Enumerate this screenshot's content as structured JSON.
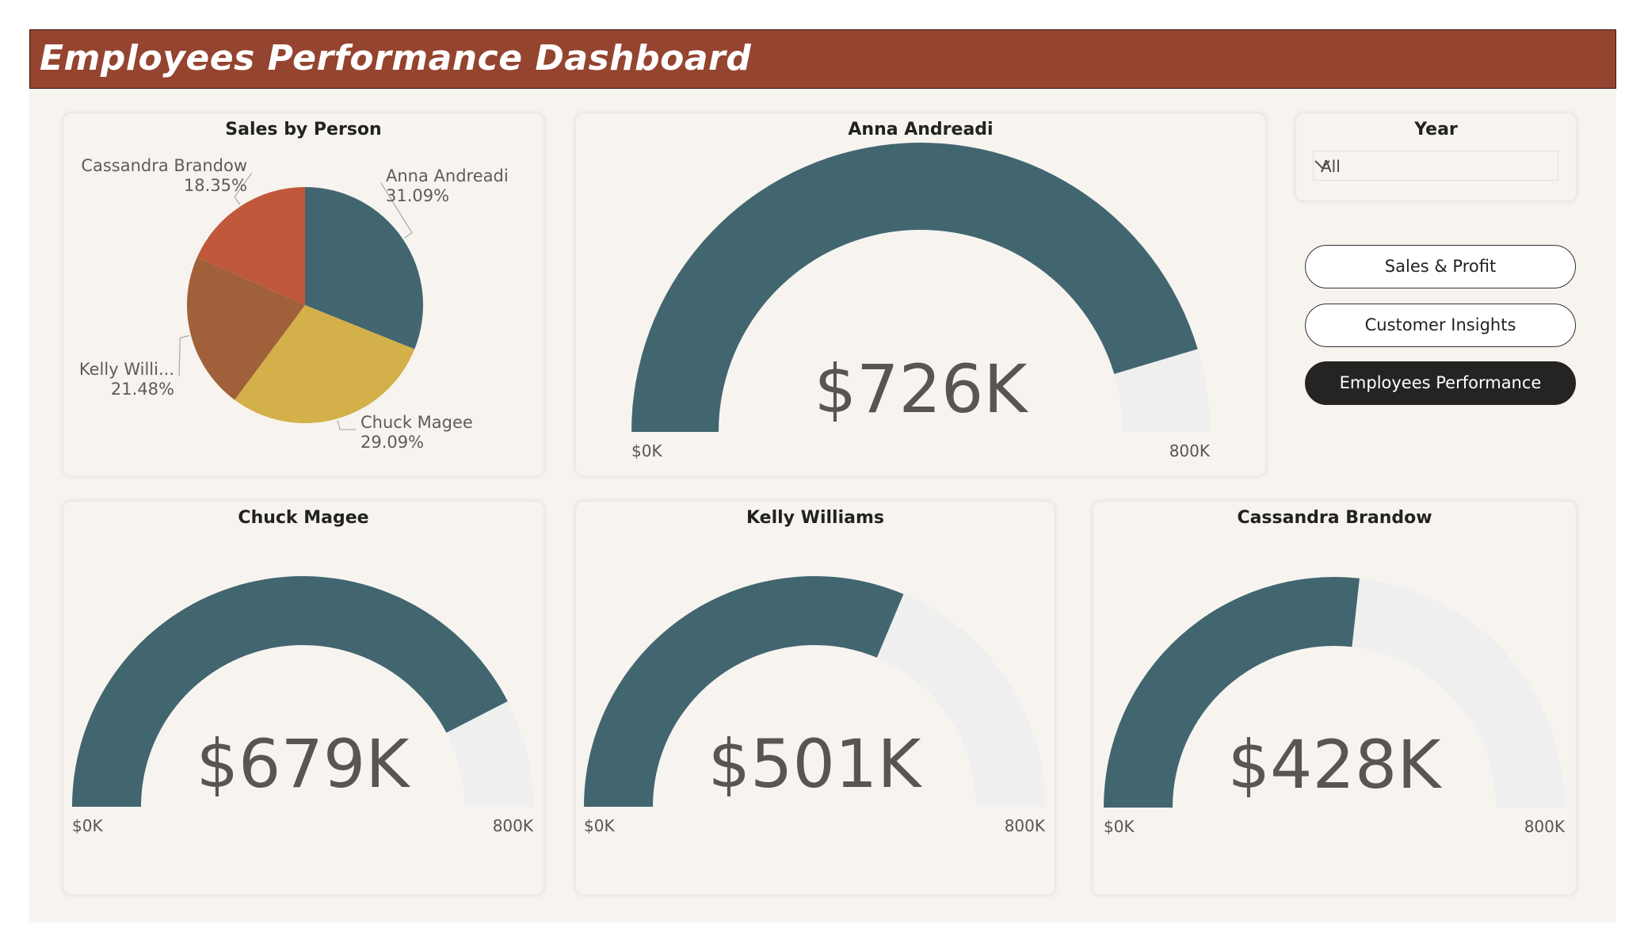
{
  "header": {
    "title": "Employees Performance Dashboard"
  },
  "pie_card": {
    "title": "Sales by Person"
  },
  "filter": {
    "label": "Year",
    "selected": "All"
  },
  "nav": {
    "buttons": [
      {
        "label": "Sales & Profit",
        "active": false
      },
      {
        "label": "Customer Insights",
        "active": false
      },
      {
        "label": "Employees Performance",
        "active": true
      }
    ]
  },
  "gauges": [
    {
      "name": "Anna Andreadi",
      "display": "$726K",
      "min_label": "$0K",
      "max_label": "800K",
      "value": 726,
      "max": 800
    },
    {
      "name": "Chuck Magee",
      "display": "$679K",
      "min_label": "$0K",
      "max_label": "800K",
      "value": 679,
      "max": 800
    },
    {
      "name": "Kelly Williams",
      "display": "$501K",
      "min_label": "$0K",
      "max_label": "800K",
      "value": 501,
      "max": 800
    },
    {
      "name": "Cassandra Brandow",
      "display": "$428K",
      "min_label": "$0K",
      "max_label": "800K",
      "value": 428,
      "max": 800
    }
  ],
  "colors": {
    "gauge_fill": "#426670",
    "gauge_track": "#efefef",
    "title_bar": "#94442f",
    "background": "#f7f4ef"
  },
  "chart_data": [
    {
      "type": "pie",
      "title": "Sales by Person",
      "categories": [
        "Anna Andreadi",
        "Chuck Magee",
        "Kelly Williams",
        "Cassandra Brandow"
      ],
      "labels": [
        "Anna Andreadi",
        "Chuck Magee",
        "Kelly Willi...",
        "Cassandra Brandow"
      ],
      "values": [
        31.09,
        29.09,
        21.48,
        18.35
      ],
      "value_labels": [
        "31.09%",
        "29.09%",
        "21.48%",
        "18.35%"
      ],
      "colors": [
        "#426670",
        "#d3b04a",
        "#a0603a",
        "#c0583b"
      ]
    }
  ]
}
